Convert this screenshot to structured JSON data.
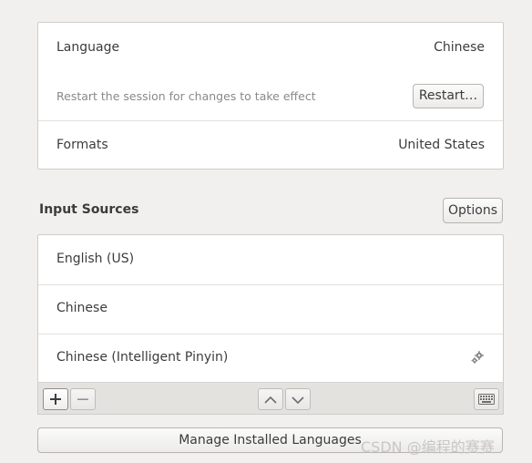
{
  "region": {
    "language_label": "Language",
    "language_value": "Chinese",
    "restart_hint": "Restart the session for changes to take effect",
    "restart_button": "Restart…",
    "formats_label": "Formats",
    "formats_value": "United States"
  },
  "input_sources": {
    "title": "Input Sources",
    "options_button": "Options",
    "items": [
      {
        "label": "English (US)"
      },
      {
        "label": "Chinese"
      },
      {
        "label": "Chinese (Intelligent Pinyin)"
      }
    ]
  },
  "toolbar": {
    "icons": [
      "add-icon",
      "remove-icon",
      "move-up-icon",
      "move-down-icon",
      "keyboard-icon"
    ]
  },
  "manage_button": "Manage Installed Languages",
  "watermark": "CSDN @编程的赛赛"
}
